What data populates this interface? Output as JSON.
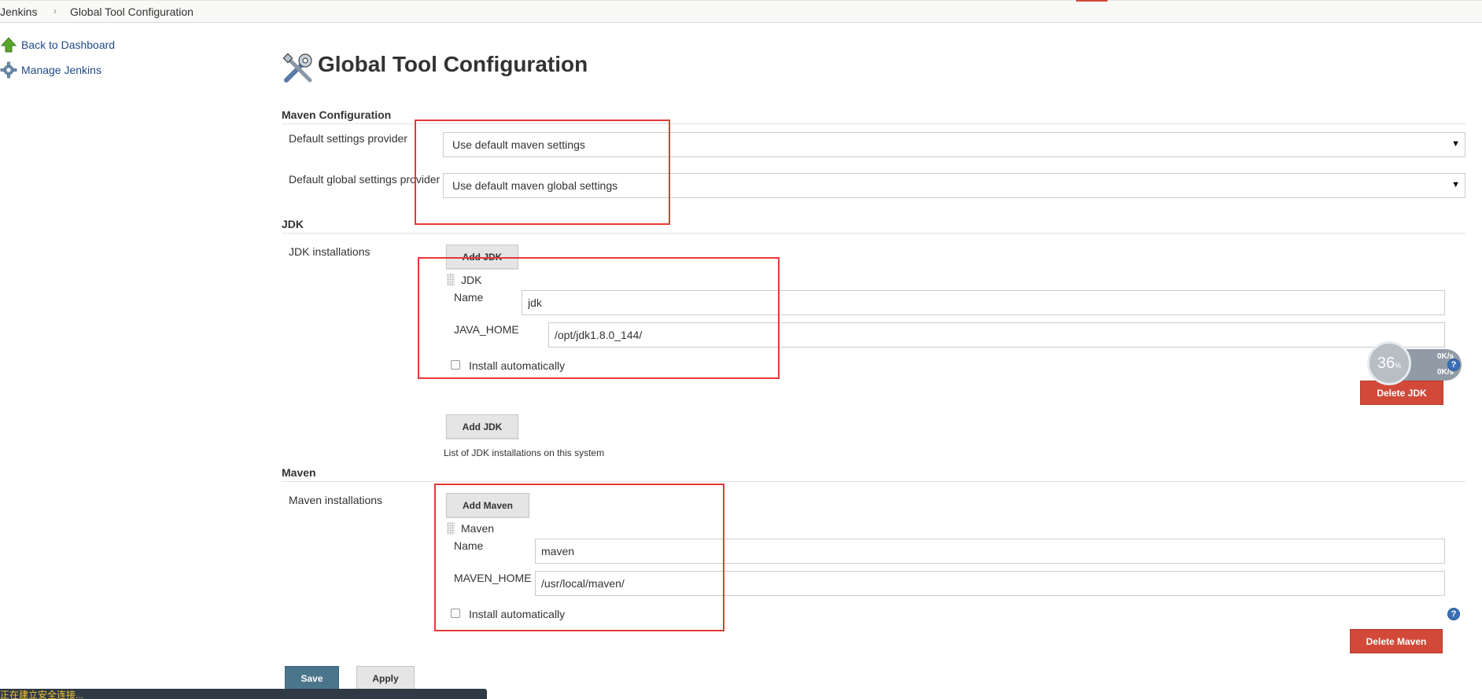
{
  "breadcrumb": {
    "items": [
      "Jenkins",
      "Global Tool Configuration"
    ],
    "separator": "›"
  },
  "sidebar": {
    "items": [
      {
        "label": "Back to Dashboard",
        "icon": "up-arrow-icon"
      },
      {
        "label": "Manage Jenkins",
        "icon": "gear-icon"
      }
    ]
  },
  "page": {
    "title": "Global Tool Configuration",
    "title_icon": "tools-icon"
  },
  "maven_config": {
    "header": "Maven Configuration",
    "settings_label": "Default settings provider",
    "settings_value": "Use default maven settings",
    "global_settings_label": "Default global settings provider",
    "global_settings_value": "Use default maven global settings"
  },
  "jdk": {
    "header": "JDK",
    "installations_label": "JDK installations",
    "add_button": "Add JDK",
    "item_title": "JDK",
    "name_label": "Name",
    "name_value": "jdk",
    "home_label": "JAVA_HOME",
    "home_value": "/opt/jdk1.8.0_144/",
    "install_auto_label": "Install automatically",
    "delete_button": "Delete JDK",
    "add_button_bottom": "Add JDK",
    "description": "List of JDK installations on this system"
  },
  "maven": {
    "header": "Maven",
    "installations_label": "Maven installations",
    "add_button": "Add Maven",
    "item_title": "Maven",
    "name_label": "Name",
    "name_value": "maven",
    "home_label": "MAVEN_HOME",
    "home_value": "/usr/local/maven/",
    "install_auto_label": "Install automatically",
    "delete_button": "Delete Maven"
  },
  "actions": {
    "save": "Save",
    "apply": "Apply"
  },
  "speed_widget": {
    "percent": "36",
    "percent_unit": "%",
    "upload": "0K/s",
    "download": "0K/s"
  },
  "help_icon_text": "?",
  "status_bar": {
    "text": "正在建立安全连接..."
  },
  "colors": {
    "link": "#204a87",
    "delete_red": "#d24939",
    "save_blue": "#4b758b",
    "annotation_red": "#e53935"
  }
}
